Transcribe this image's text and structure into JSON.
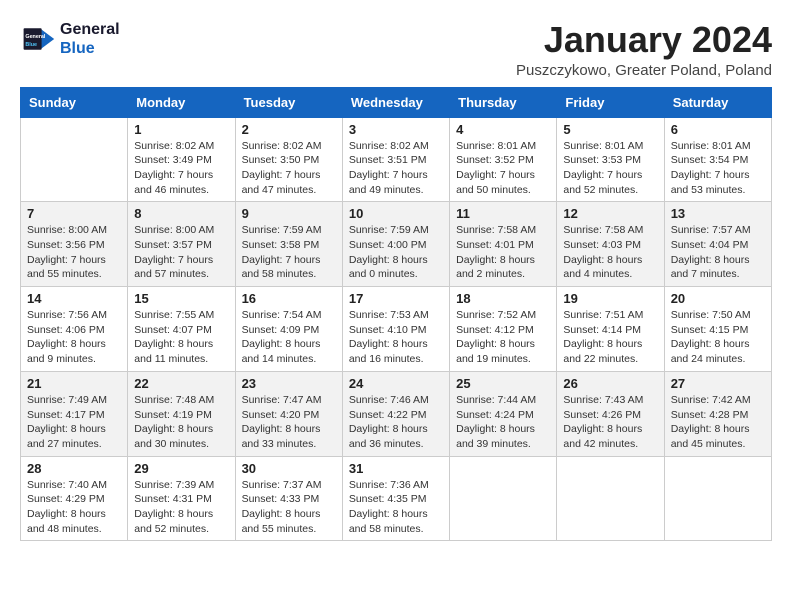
{
  "logo": {
    "line1": "General",
    "line2": "Blue"
  },
  "header": {
    "title": "January 2024",
    "subtitle": "Puszczykowo, Greater Poland, Poland"
  },
  "days_of_week": [
    "Sunday",
    "Monday",
    "Tuesday",
    "Wednesday",
    "Thursday",
    "Friday",
    "Saturday"
  ],
  "weeks": [
    [
      {
        "day": "",
        "info": ""
      },
      {
        "day": "1",
        "info": "Sunrise: 8:02 AM\nSunset: 3:49 PM\nDaylight: 7 hours\nand 46 minutes."
      },
      {
        "day": "2",
        "info": "Sunrise: 8:02 AM\nSunset: 3:50 PM\nDaylight: 7 hours\nand 47 minutes."
      },
      {
        "day": "3",
        "info": "Sunrise: 8:02 AM\nSunset: 3:51 PM\nDaylight: 7 hours\nand 49 minutes."
      },
      {
        "day": "4",
        "info": "Sunrise: 8:01 AM\nSunset: 3:52 PM\nDaylight: 7 hours\nand 50 minutes."
      },
      {
        "day": "5",
        "info": "Sunrise: 8:01 AM\nSunset: 3:53 PM\nDaylight: 7 hours\nand 52 minutes."
      },
      {
        "day": "6",
        "info": "Sunrise: 8:01 AM\nSunset: 3:54 PM\nDaylight: 7 hours\nand 53 minutes."
      }
    ],
    [
      {
        "day": "7",
        "info": "Sunrise: 8:00 AM\nSunset: 3:56 PM\nDaylight: 7 hours\nand 55 minutes."
      },
      {
        "day": "8",
        "info": "Sunrise: 8:00 AM\nSunset: 3:57 PM\nDaylight: 7 hours\nand 57 minutes."
      },
      {
        "day": "9",
        "info": "Sunrise: 7:59 AM\nSunset: 3:58 PM\nDaylight: 7 hours\nand 58 minutes."
      },
      {
        "day": "10",
        "info": "Sunrise: 7:59 AM\nSunset: 4:00 PM\nDaylight: 8 hours\nand 0 minutes."
      },
      {
        "day": "11",
        "info": "Sunrise: 7:58 AM\nSunset: 4:01 PM\nDaylight: 8 hours\nand 2 minutes."
      },
      {
        "day": "12",
        "info": "Sunrise: 7:58 AM\nSunset: 4:03 PM\nDaylight: 8 hours\nand 4 minutes."
      },
      {
        "day": "13",
        "info": "Sunrise: 7:57 AM\nSunset: 4:04 PM\nDaylight: 8 hours\nand 7 minutes."
      }
    ],
    [
      {
        "day": "14",
        "info": "Sunrise: 7:56 AM\nSunset: 4:06 PM\nDaylight: 8 hours\nand 9 minutes."
      },
      {
        "day": "15",
        "info": "Sunrise: 7:55 AM\nSunset: 4:07 PM\nDaylight: 8 hours\nand 11 minutes."
      },
      {
        "day": "16",
        "info": "Sunrise: 7:54 AM\nSunset: 4:09 PM\nDaylight: 8 hours\nand 14 minutes."
      },
      {
        "day": "17",
        "info": "Sunrise: 7:53 AM\nSunset: 4:10 PM\nDaylight: 8 hours\nand 16 minutes."
      },
      {
        "day": "18",
        "info": "Sunrise: 7:52 AM\nSunset: 4:12 PM\nDaylight: 8 hours\nand 19 minutes."
      },
      {
        "day": "19",
        "info": "Sunrise: 7:51 AM\nSunset: 4:14 PM\nDaylight: 8 hours\nand 22 minutes."
      },
      {
        "day": "20",
        "info": "Sunrise: 7:50 AM\nSunset: 4:15 PM\nDaylight: 8 hours\nand 24 minutes."
      }
    ],
    [
      {
        "day": "21",
        "info": "Sunrise: 7:49 AM\nSunset: 4:17 PM\nDaylight: 8 hours\nand 27 minutes."
      },
      {
        "day": "22",
        "info": "Sunrise: 7:48 AM\nSunset: 4:19 PM\nDaylight: 8 hours\nand 30 minutes."
      },
      {
        "day": "23",
        "info": "Sunrise: 7:47 AM\nSunset: 4:20 PM\nDaylight: 8 hours\nand 33 minutes."
      },
      {
        "day": "24",
        "info": "Sunrise: 7:46 AM\nSunset: 4:22 PM\nDaylight: 8 hours\nand 36 minutes."
      },
      {
        "day": "25",
        "info": "Sunrise: 7:44 AM\nSunset: 4:24 PM\nDaylight: 8 hours\nand 39 minutes."
      },
      {
        "day": "26",
        "info": "Sunrise: 7:43 AM\nSunset: 4:26 PM\nDaylight: 8 hours\nand 42 minutes."
      },
      {
        "day": "27",
        "info": "Sunrise: 7:42 AM\nSunset: 4:28 PM\nDaylight: 8 hours\nand 45 minutes."
      }
    ],
    [
      {
        "day": "28",
        "info": "Sunrise: 7:40 AM\nSunset: 4:29 PM\nDaylight: 8 hours\nand 48 minutes."
      },
      {
        "day": "29",
        "info": "Sunrise: 7:39 AM\nSunset: 4:31 PM\nDaylight: 8 hours\nand 52 minutes."
      },
      {
        "day": "30",
        "info": "Sunrise: 7:37 AM\nSunset: 4:33 PM\nDaylight: 8 hours\nand 55 minutes."
      },
      {
        "day": "31",
        "info": "Sunrise: 7:36 AM\nSunset: 4:35 PM\nDaylight: 8 hours\nand 58 minutes."
      },
      {
        "day": "",
        "info": ""
      },
      {
        "day": "",
        "info": ""
      },
      {
        "day": "",
        "info": ""
      }
    ]
  ]
}
